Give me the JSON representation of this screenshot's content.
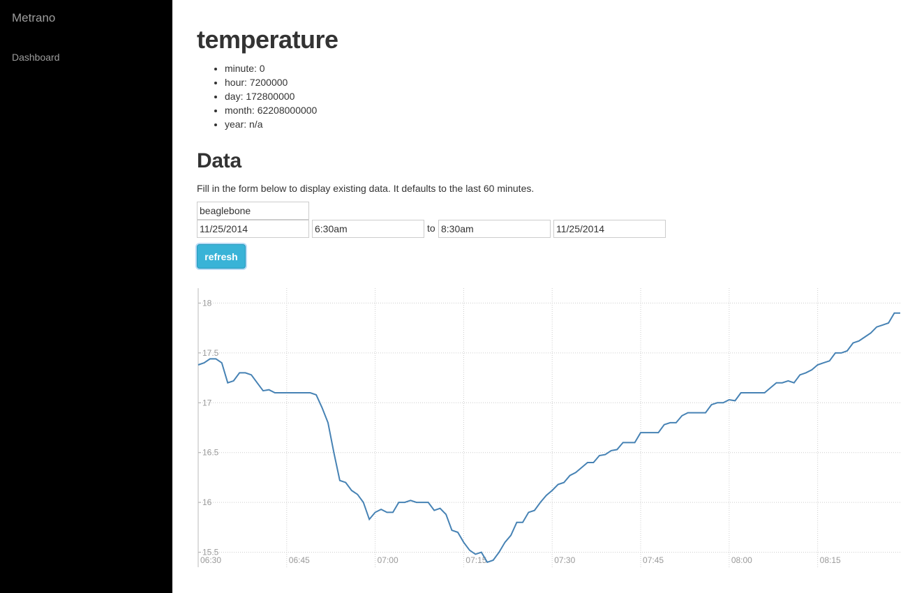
{
  "sidebar": {
    "brand": "Metrano",
    "nav": [
      {
        "label": "Dashboard"
      }
    ]
  },
  "page": {
    "title": "temperature",
    "params": [
      {
        "text": "minute: 0"
      },
      {
        "text": "hour: 7200000"
      },
      {
        "text": "day: 172800000"
      },
      {
        "text": "month: 62208000000"
      },
      {
        "text": "year: n/a"
      }
    ]
  },
  "data_section": {
    "heading": "Data",
    "description": "Fill in the form below to display existing data. It defaults to the last 60 minutes.",
    "form": {
      "source": "beaglebone",
      "from_date": "11/25/2014",
      "from_time": "6:30am",
      "to_label": "to",
      "to_time": "8:30am",
      "to_date": "11/25/2014",
      "refresh_label": "refresh"
    }
  },
  "chart_data": {
    "type": "line",
    "x_ticks": [
      "06:30",
      "06:45",
      "07:00",
      "07:15",
      "07:30",
      "07:45",
      "08:00",
      "08:15"
    ],
    "y_ticks": [
      "15.5",
      "16",
      "16.5",
      "17",
      "17.5",
      "18"
    ],
    "ylim": [
      15.35,
      18.15
    ],
    "xlim_minutes": [
      "06:30",
      "08:29"
    ],
    "grid": true,
    "line_color": "#4682b4",
    "series": [
      {
        "x": [
          "06:30",
          "06:31",
          "06:32",
          "06:33",
          "06:34",
          "06:35",
          "06:36",
          "06:37",
          "06:38",
          "06:39",
          "06:40",
          "06:41",
          "06:42",
          "06:43",
          "06:44",
          "06:45",
          "06:46",
          "06:47",
          "06:48",
          "06:49",
          "06:50",
          "06:51",
          "06:52",
          "06:53",
          "06:54",
          "06:55",
          "06:56",
          "06:57",
          "06:58",
          "06:59",
          "07:00",
          "07:01",
          "07:02",
          "07:03",
          "07:04",
          "07:05",
          "07:06",
          "07:07",
          "07:08",
          "07:09",
          "07:10",
          "07:11",
          "07:12",
          "07:13",
          "07:14",
          "07:15",
          "07:16",
          "07:17",
          "07:18",
          "07:19",
          "07:20",
          "07:21",
          "07:22",
          "07:23",
          "07:24",
          "07:25",
          "07:26",
          "07:27",
          "07:28",
          "07:29",
          "07:30",
          "07:31",
          "07:32",
          "07:33",
          "07:34",
          "07:35",
          "07:36",
          "07:37",
          "07:38",
          "07:39",
          "07:40",
          "07:41",
          "07:42",
          "07:43",
          "07:44",
          "07:45",
          "07:46",
          "07:47",
          "07:48",
          "07:49",
          "07:50",
          "07:51",
          "07:52",
          "07:53",
          "07:54",
          "07:55",
          "07:56",
          "07:57",
          "07:58",
          "07:59",
          "08:00",
          "08:01",
          "08:02",
          "08:03",
          "08:04",
          "08:05",
          "08:06",
          "08:07",
          "08:08",
          "08:09",
          "08:10",
          "08:11",
          "08:12",
          "08:13",
          "08:14",
          "08:15",
          "08:16",
          "08:17",
          "08:18",
          "08:19",
          "08:20",
          "08:21",
          "08:22",
          "08:23",
          "08:24",
          "08:25",
          "08:26",
          "08:27",
          "08:28",
          "08:29"
        ],
        "values": [
          17.38,
          17.4,
          17.44,
          17.44,
          17.4,
          17.2,
          17.22,
          17.3,
          17.3,
          17.28,
          17.2,
          17.12,
          17.13,
          17.1,
          17.1,
          17.1,
          17.1,
          17.1,
          17.1,
          17.1,
          17.08,
          16.95,
          16.8,
          16.5,
          16.22,
          16.2,
          16.12,
          16.08,
          16.0,
          15.83,
          15.9,
          15.93,
          15.9,
          15.9,
          16.0,
          16.0,
          16.02,
          16.0,
          16.0,
          16.0,
          15.92,
          15.94,
          15.88,
          15.72,
          15.7,
          15.6,
          15.52,
          15.48,
          15.5,
          15.4,
          15.42,
          15.5,
          15.6,
          15.67,
          15.8,
          15.8,
          15.9,
          15.92,
          16.0,
          16.07,
          16.12,
          16.18,
          16.2,
          16.27,
          16.3,
          16.35,
          16.4,
          16.4,
          16.47,
          16.48,
          16.52,
          16.53,
          16.6,
          16.6,
          16.6,
          16.7,
          16.7,
          16.7,
          16.7,
          16.78,
          16.8,
          16.8,
          16.87,
          16.9,
          16.9,
          16.9,
          16.9,
          16.98,
          17.0,
          17.0,
          17.03,
          17.02,
          17.1,
          17.1,
          17.1,
          17.1,
          17.1,
          17.15,
          17.2,
          17.2,
          17.22,
          17.2,
          17.28,
          17.3,
          17.33,
          17.38,
          17.4,
          17.42,
          17.5,
          17.5,
          17.52,
          17.6,
          17.62,
          17.66,
          17.7,
          17.76,
          17.78,
          17.8,
          17.9,
          17.9
        ]
      }
    ]
  }
}
